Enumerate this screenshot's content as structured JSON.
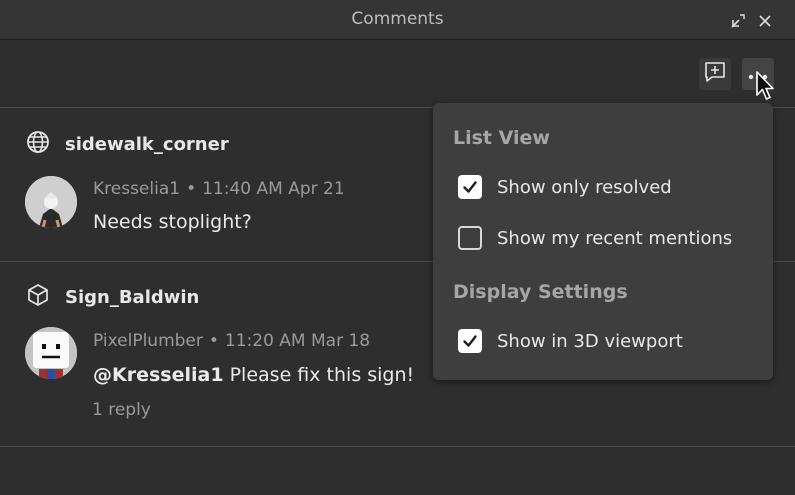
{
  "window": {
    "title": "Comments",
    "icons": {
      "restore": "dock-restore-icon",
      "close": "close-icon"
    }
  },
  "toolbar": {
    "add_comment_icon": "add-comment-icon",
    "more_icon": "more-options-icon"
  },
  "threads": [
    {
      "place_icon": "globe-icon",
      "place": "sidewalk_corner",
      "comments": [
        {
          "author": "Kresselia1",
          "separator": "•",
          "time": "11:40 AM Apr 21",
          "mention": "",
          "text": "Needs stoplight?"
        }
      ],
      "reply_label": ""
    },
    {
      "place_icon": "cube-icon",
      "place": "Sign_Baldwin",
      "comments": [
        {
          "author": "PixelPlumber",
          "separator": "•",
          "time": "11:20 AM Mar 18",
          "mention": "@Kresselia1",
          "text": " Please fix this sign!"
        }
      ],
      "reply_label": "1 reply"
    }
  ],
  "menu": {
    "sections": [
      {
        "title": "List View",
        "items": [
          {
            "label": "Show only resolved",
            "checked": true
          },
          {
            "label": "Show my recent mentions",
            "checked": false
          }
        ]
      },
      {
        "title": "Display Settings",
        "items": [
          {
            "label": "Show in 3D viewport",
            "checked": true
          }
        ]
      }
    ]
  },
  "colors": {
    "background": "#2e2e2e",
    "menu_background": "#3e3e3e",
    "separator": "#4a4a4a",
    "muted_text": "#9a9a9a"
  }
}
